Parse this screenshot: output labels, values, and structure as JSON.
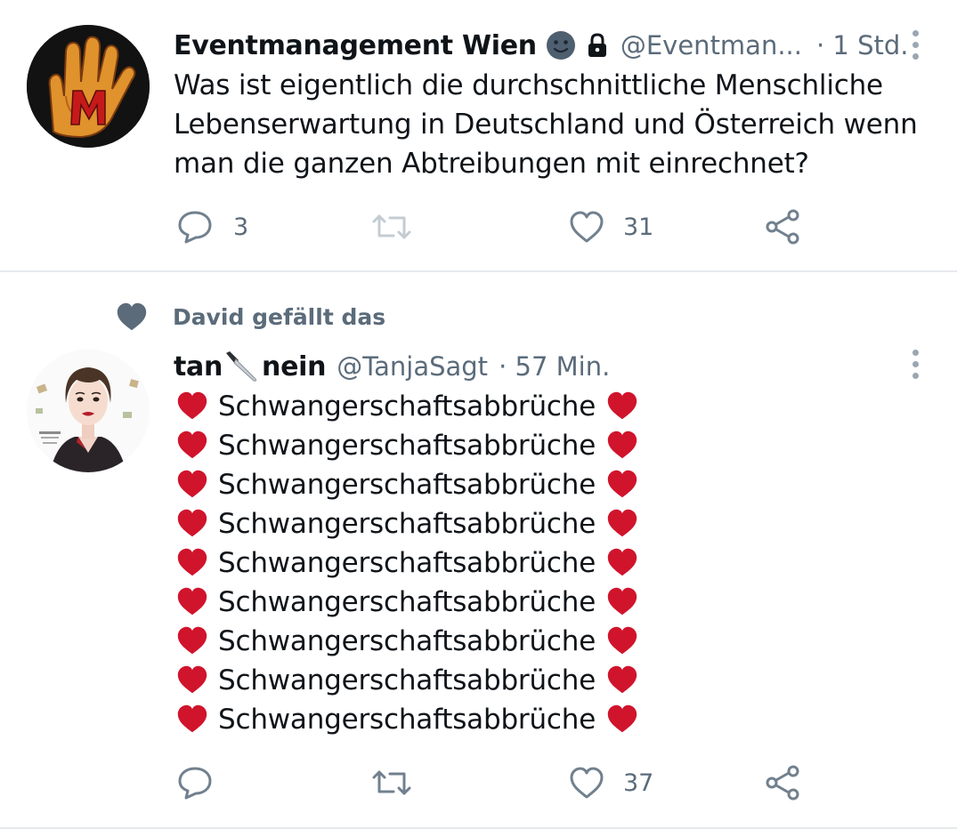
{
  "tweet1": {
    "display_name": "Eventmanagement Wien",
    "name_emojis": [
      "face-emoji-icon",
      "lock-icon"
    ],
    "handle": "@Eventman...",
    "time": "· 1 Std.",
    "text_lines": [
      "Was ist eigentlich die durchschnittliche Menschliche",
      "Lebenserwartung in Deutschland und Österreich wenn",
      "man die ganzen Abtreibungen mit einrechnet?"
    ],
    "actions": {
      "reply_count": "3",
      "retweet_count": "",
      "like_count": "31"
    }
  },
  "social_context": {
    "text": "David gefällt das",
    "icon": "heart-icon"
  },
  "tweet2": {
    "display_name_start": "tan",
    "display_name_end": "nein",
    "name_emoji": "knife-emoji-icon",
    "handle": "@TanjaSagt",
    "time": "· 57 Min.",
    "lines": [
      "Schwangerschaftsabbrüche",
      "Schwangerschaftsabbrüche",
      "Schwangerschaftsabbrüche",
      "Schwangerschaftsabbrüche",
      "Schwangerschaftsabbrüche",
      "Schwangerschaftsabbrüche",
      "Schwangerschaftsabbrüche",
      "Schwangerschaftsabbrüche",
      "Schwangerschaftsabbrüche"
    ],
    "line_emoji": "red-heart-emoji-icon",
    "actions": {
      "reply_count": "",
      "retweet_count": "",
      "like_count": "37"
    }
  },
  "colors": {
    "text": "#0f1419",
    "secondary": "#5b6b7a",
    "icon": "#71808e",
    "heart_red": "#d0142c",
    "divider": "#e6e9ec"
  }
}
